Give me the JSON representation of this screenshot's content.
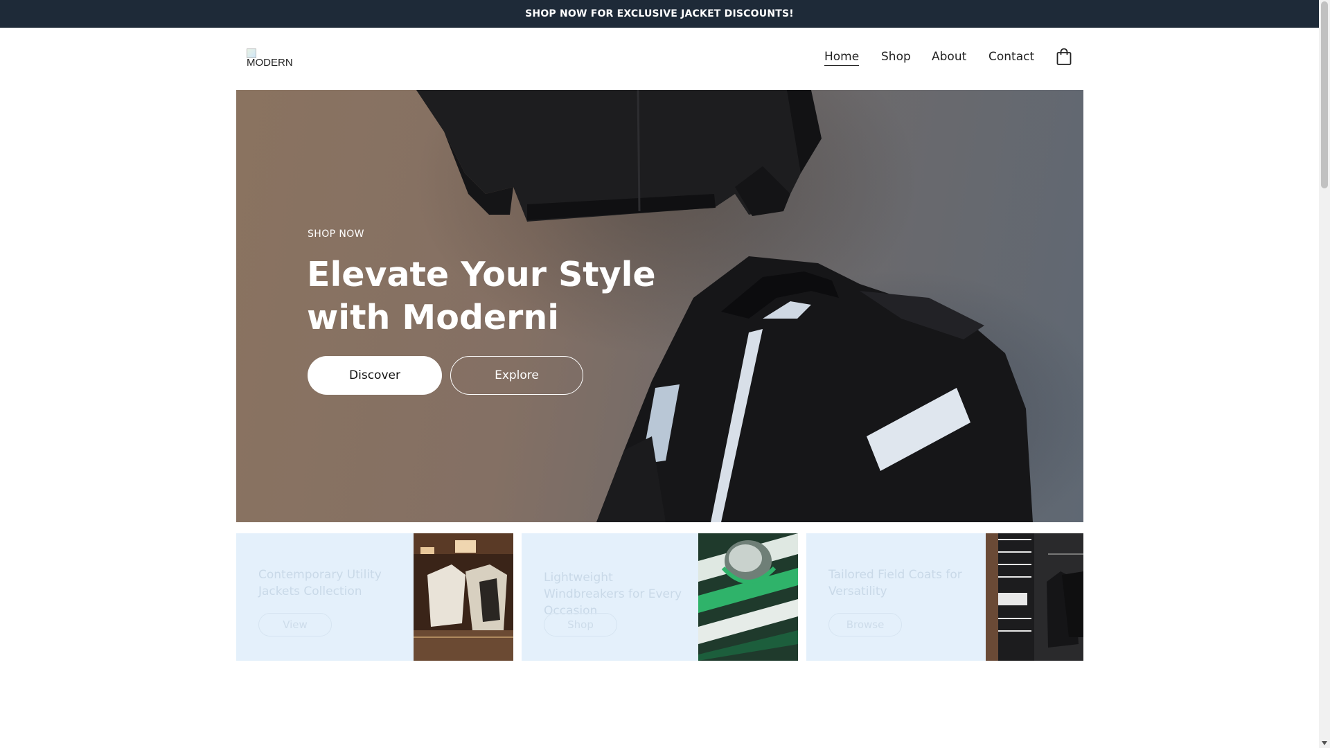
{
  "announcement": "SHOP NOW FOR EXCLUSIVE JACKET DISCOUNTS!",
  "logo": {
    "text": "MODERNI"
  },
  "nav": {
    "items": [
      {
        "label": "Home",
        "active": true
      },
      {
        "label": "Shop",
        "active": false
      },
      {
        "label": "About",
        "active": false
      },
      {
        "label": "Contact",
        "active": false
      }
    ],
    "cart_icon": "shopping-bag-icon"
  },
  "hero": {
    "eyebrow": "SHOP NOW",
    "title": "Elevate Your Style with Moderni",
    "primary_button": "Discover",
    "secondary_button": "Explore"
  },
  "cards": [
    {
      "title": "Contemporary Utility Jackets Collection",
      "button": "View"
    },
    {
      "title": "Lightweight Windbreakers for Every Occasion",
      "button": "Shop"
    },
    {
      "title": "Tailored Field Coats for Versatility",
      "button": "Browse"
    }
  ],
  "colors": {
    "announcement_bg": "#1e2a38",
    "card_bg": "#e4f0fb",
    "text": "#222222"
  }
}
